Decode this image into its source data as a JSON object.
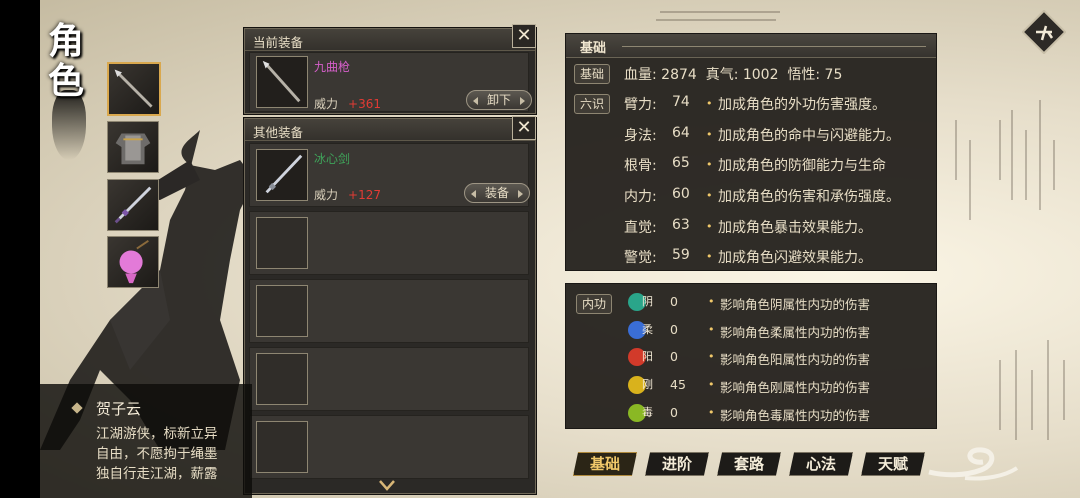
{
  "page_title": "角色",
  "title_chars": [
    "角",
    "色"
  ],
  "equip_slots": [
    {
      "icon": "spear-icon",
      "selected": true
    },
    {
      "icon": "armor-icon",
      "selected": false
    },
    {
      "icon": "sword-icon",
      "selected": false
    },
    {
      "icon": "pouch-icon",
      "selected": false
    }
  ],
  "character": {
    "name": "贺子云",
    "description": "江湖游侠，标新立异\n自由，不愿拘于绳墨\n独自行走江湖，薪露"
  },
  "current_equip": {
    "header": "当前装备",
    "item": {
      "name": "九曲枪",
      "name_color": "#d45fc9",
      "power_label": "威力",
      "power_value": "+361",
      "icon": "spear-icon"
    },
    "button": "卸下"
  },
  "other_equip": {
    "header": "其他装备",
    "items": [
      {
        "name": "冰心剑",
        "name_color": "#3fa35a",
        "power_label": "威力",
        "power_value": "+127",
        "icon": "sword-icon",
        "button": "装备"
      }
    ],
    "empty_slots": 4
  },
  "close_symbol": "✕",
  "stats": {
    "header": "基础",
    "basic_tag": "基础",
    "six_tag": "六识",
    "top_line": "血量: 2874  真气: 1002  悟性: 75",
    "rows": [
      {
        "label": "臂力:",
        "value": "74",
        "desc": "加成角色的外功伤害强度。"
      },
      {
        "label": "身法:",
        "value": "64",
        "desc": "加成角色的命中与闪避能力。"
      },
      {
        "label": "根骨:",
        "value": "65",
        "desc": "加成角色的防御能力与生命"
      },
      {
        "label": "内力:",
        "value": "60",
        "desc": "加成角色的伤害和承伤强度。"
      },
      {
        "label": "直觉:",
        "value": "63",
        "desc": "加成角色暴击效果能力。"
      },
      {
        "label": "警觉:",
        "value": "59",
        "desc": "加成角色闪避效果能力。"
      }
    ]
  },
  "neigong": {
    "tag": "内功",
    "rows": [
      {
        "element": "阴",
        "value": "0",
        "color": "#2aa58a",
        "desc": "影响角色阴属性内功的伤害"
      },
      {
        "element": "柔",
        "value": "0",
        "color": "#3a6ed6",
        "desc": "影响角色柔属性内功的伤害"
      },
      {
        "element": "阳",
        "value": "0",
        "color": "#d23a2a",
        "desc": "影响角色阳属性内功的伤害"
      },
      {
        "element": "刚",
        "value": "45",
        "color": "#d9b21c",
        "desc": "影响角色刚属性内功的伤害"
      },
      {
        "element": "毒",
        "value": "0",
        "color": "#8ab824",
        "desc": "影响角色毒属性内功的伤害"
      }
    ]
  },
  "tabs": [
    {
      "label": "基础",
      "active": true
    },
    {
      "label": "进阶",
      "active": false
    },
    {
      "label": "套路",
      "active": false
    },
    {
      "label": "心法",
      "active": false
    },
    {
      "label": "天赋",
      "active": false
    }
  ],
  "colors": {
    "accent_gold": "#f0c86a",
    "power_red": "#e23b34",
    "panel_bg": "#2b2926"
  }
}
